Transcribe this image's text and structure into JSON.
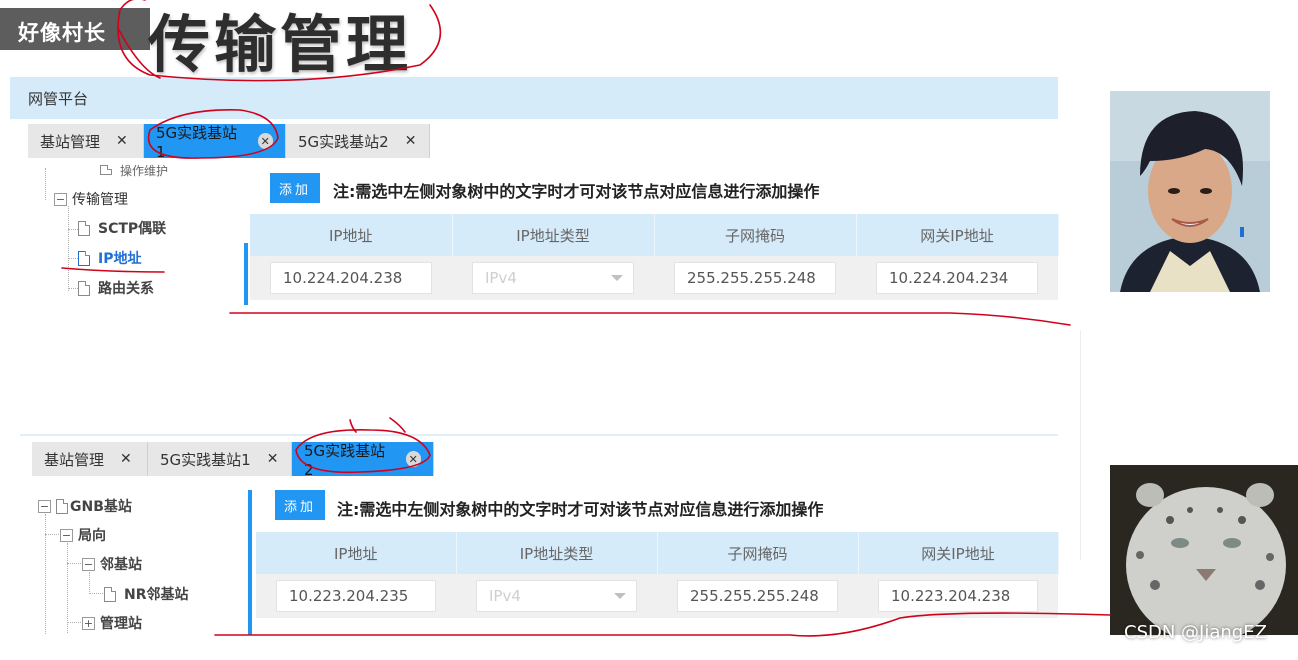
{
  "brand": "好像村长",
  "main_title": "传输管理",
  "platform": "网管平台",
  "accent_color": "#2196f3",
  "header_bg": "#d6ebfa",
  "annotation_color": "#d0021b",
  "top": {
    "tabs": [
      {
        "label": "基站管理",
        "active": false
      },
      {
        "label": "5G实践基站1",
        "active": true
      },
      {
        "label": "5G实践基站2",
        "active": false
      }
    ],
    "tree": {
      "partial": "操作维护",
      "node": "传输管理",
      "children": [
        "SCTP偶联",
        "IP地址",
        "路由关系"
      ],
      "selected": "IP地址"
    },
    "add_label": "添加",
    "note": "注:需选中左侧对象树中的文字时才可对该节点对应信息进行添加操作",
    "columns": [
      "IP地址",
      "IP地址类型",
      "子网掩码",
      "网关IP地址"
    ],
    "row": {
      "ip": "10.224.204.238",
      "ip_type": "IPv4",
      "mask": "255.255.255.248",
      "gateway": "10.224.204.234"
    }
  },
  "bottom": {
    "tabs": [
      {
        "label": "基站管理",
        "active": false
      },
      {
        "label": "5G实践基站1",
        "active": false
      },
      {
        "label": "5G实践基站2",
        "active": true
      }
    ],
    "tree": {
      "root": "GNB基站",
      "level1": "局向",
      "level2": "邻基站",
      "level3": "NR邻基站",
      "sibling": "管理站"
    },
    "add_label": "添加",
    "note": "注:需选中左侧对象树中的文字时才可对该节点对应信息进行添加操作",
    "columns": [
      "IP地址",
      "IP地址类型",
      "子网掩码",
      "网关IP地址"
    ],
    "row": {
      "ip": "10.223.204.235",
      "ip_type": "IPv4",
      "mask": "255.255.255.248",
      "gateway": "10.223.204.238"
    }
  },
  "watermark": "CSDN @JiangEZ"
}
